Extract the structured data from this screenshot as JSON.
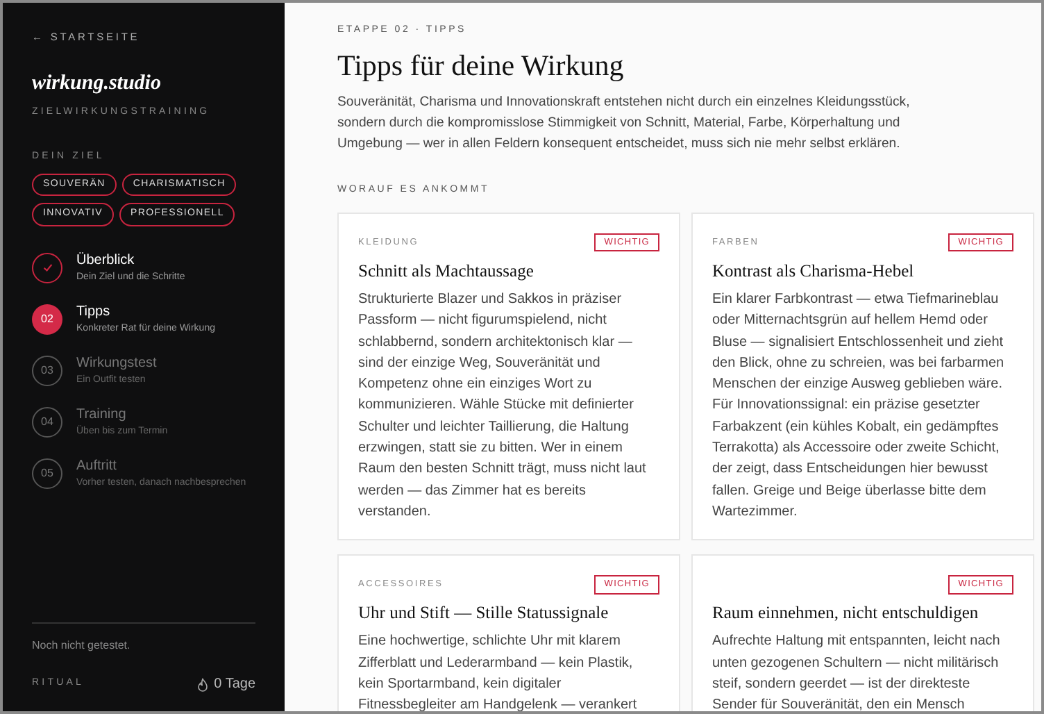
{
  "sidebar": {
    "back_link": "← STARTSEITE",
    "brand": "wirkung.studio",
    "subtitle": "ZIELWIRKUNGSTRAINING",
    "goal_label": "DEIN ZIEL",
    "goals": [
      "SOUVERÄN",
      "CHARISMATISCH",
      "INNOVATIV",
      "PROFESSIONELL"
    ],
    "steps": [
      {
        "title": "Überblick",
        "subtitle": "Dein Ziel und die Schritte",
        "kind": "done"
      },
      {
        "number": "02",
        "title": "Tipps",
        "subtitle": "Konkreter Rat für deine Wirkung",
        "kind": "current"
      },
      {
        "number": "03",
        "title": "Wirkungstest",
        "subtitle": "Ein Outfit testen",
        "kind": "upcoming"
      },
      {
        "number": "04",
        "title": "Training",
        "subtitle": "Üben bis zum Termin",
        "kind": "upcoming"
      },
      {
        "number": "05",
        "title": "Auftritt",
        "subtitle": "Vorher testen, danach nachbesprechen",
        "kind": "upcoming"
      }
    ],
    "status": "Noch nicht getestet.",
    "ritual_label": "RITUAL",
    "streak": "0 Tage"
  },
  "main": {
    "eyebrow": "ETAPPE 02 · TIPPS",
    "title": "Tipps für deine Wirkung",
    "intro": "Souveränität, Charisma und Innovationskraft entstehen nicht durch ein einzelnes Kleidungsstück, sondern durch die kompromisslose Stimmigkeit von Schnitt, Material, Farbe, Körperhaltung und Umgebung — wer in allen Feldern konsequent entscheidet, muss sich nie mehr selbst erklären.",
    "section_label": "WORAUF ES ANKOMMT",
    "cards": [
      {
        "category": "KLEIDUNG",
        "badge": "WICHTIG",
        "title": "Schnitt als Machtaussage",
        "body": "Strukturierte Blazer und Sakkos in präziser Passform — nicht figurumspielend, nicht schlabbernd, sondern architektonisch klar — sind der einzige Weg, Souveränität und Kompetenz ohne ein einziges Wort zu kommunizieren. Wähle Stücke mit definierter Schulter und leichter Taillierung, die Haltung erzwingen, statt sie zu bitten. Wer in einem Raum den besten Schnitt trägt, muss nicht laut werden — das Zimmer hat es bereits verstanden."
      },
      {
        "category": "FARBEN",
        "badge": "WICHTIG",
        "title": "Kontrast als Charisma-Hebel",
        "body": "Ein klarer Farbkontrast — etwa Tiefmarineblau oder Mitternachtsgrün auf hellem Hemd oder Bluse — signalisiert Entschlossenheit und zieht den Blick, ohne zu schreien, was bei farbarmen Menschen der einzige Ausweg geblieben wäre. Für Innovationssignal: ein präzise gesetzter Farbakzent (ein kühles Kobalt, ein gedämpftes Terrakotta) als Accessoire oder zweite Schicht, der zeigt, dass Entscheidungen hier bewusst fallen. Greige und Beige überlasse bitte dem Wartezimmer."
      },
      {
        "category": "ACCESSOIRES",
        "badge": "WICHTIG",
        "title": "Uhr und Stift — Stille Statussignale",
        "body": "Eine hochwertige, schlichte Uhr mit klarem Zifferblatt und Lederarmband — kein Plastik, kein Sportarmband, kein digitaler Fitnessbegleiter am Handgelenk — verankert"
      },
      {
        "badge": "WICHTIG",
        "title": "Raum einnehmen, nicht entschuldigen",
        "body": "Aufrechte Haltung mit entspannten, leicht nach unten gezogenen Schultern — nicht militärisch steif, sondern geerdet — ist der direkteste Sender für Souveränität, den ein Mensch"
      }
    ]
  }
}
